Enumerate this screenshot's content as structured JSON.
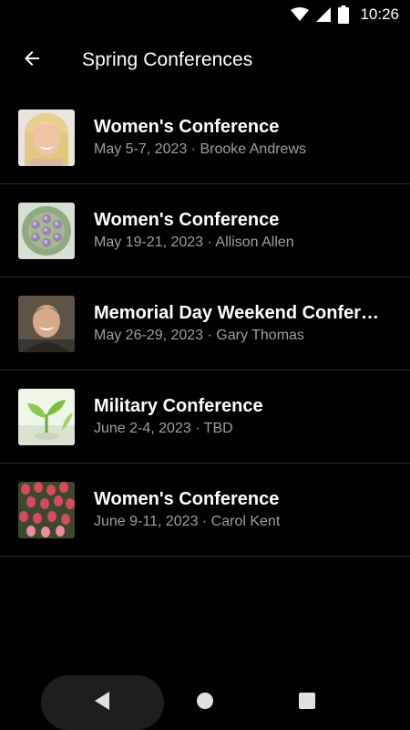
{
  "status_bar": {
    "time": "10:26",
    "icons": [
      "wifi-icon",
      "cell-signal-icon",
      "battery-icon"
    ]
  },
  "app_bar": {
    "title": "Spring Conferences",
    "back_icon": "arrow-back-icon"
  },
  "conferences": [
    {
      "title": "Women's Conference",
      "subtitle": "May 5-7, 2023 · Brooke Andrews",
      "thumb": "woman-portrait"
    },
    {
      "title": "Women's Conference",
      "subtitle": "May 19-21, 2023 · Allison Allen",
      "thumb": "purple-flowers"
    },
    {
      "title": "Memorial Day Weekend Confere…",
      "subtitle": "May 26-29, 2023 · Gary Thomas",
      "thumb": "man-portrait"
    },
    {
      "title": "Military Conference",
      "subtitle": "June 2-4, 2023 · TBD",
      "thumb": "green-sprout"
    },
    {
      "title": "Women's Conference",
      "subtitle": "June 9-11, 2023 · Carol Kent",
      "thumb": "tulips"
    }
  ],
  "nav_bar": {
    "buttons": [
      "back-triangle-icon",
      "home-circle-icon",
      "recents-square-icon"
    ]
  }
}
